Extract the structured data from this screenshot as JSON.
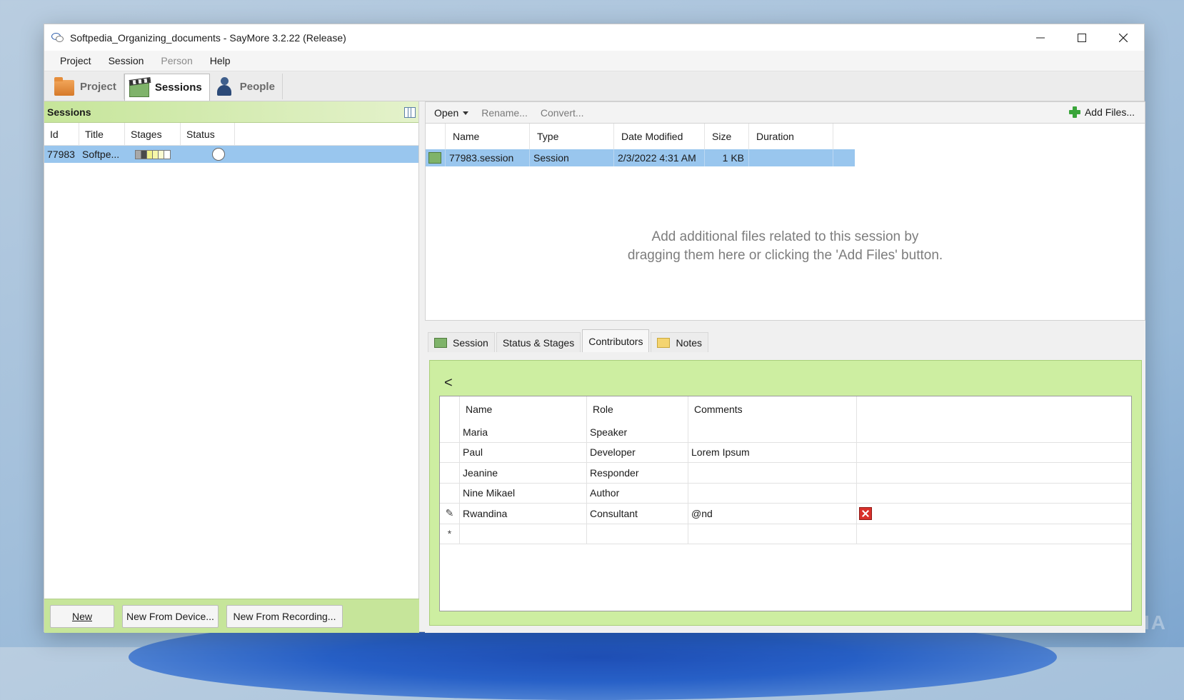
{
  "window": {
    "title": "Softpedia_Organizing_documents - SayMore 3.2.22 (Release)"
  },
  "menu": [
    "Project",
    "Session",
    "Person",
    "Help"
  ],
  "main_tabs": [
    {
      "label": "Project",
      "icon": "folder-icon"
    },
    {
      "label": "Sessions",
      "icon": "clapperboard-icon"
    },
    {
      "label": "People",
      "icon": "person-icon"
    }
  ],
  "sessions_panel": {
    "title": "Sessions",
    "columns": [
      "Id",
      "Title",
      "Stages",
      "Status"
    ],
    "rows": [
      {
        "id": "77983",
        "title": "Softpe...",
        "stage_colors": [
          "#a8a8a8",
          "#4a4a4a",
          "#f2f28a",
          "#f6f6aa",
          "#fafad0",
          "#ffffff"
        ]
      }
    ],
    "buttons": [
      "New",
      "New From Device...",
      "New From Recording..."
    ]
  },
  "file_toolbar": {
    "open": "Open",
    "rename": "Rename...",
    "convert": "Convert...",
    "add_files": "Add Files..."
  },
  "files": {
    "columns": [
      "Name",
      "Type",
      "Date Modified",
      "Size",
      "Duration"
    ],
    "rows": [
      {
        "name": "77983.session",
        "type": "Session",
        "date": "2/3/2022 4:31 AM",
        "size": "1 KB",
        "duration": ""
      }
    ],
    "hint_line1": "Add additional files related to this session by",
    "hint_line2": "dragging them here or clicking the 'Add Files' button."
  },
  "detail_tabs": [
    "Session",
    "Status & Stages",
    "Contributors",
    "Notes"
  ],
  "contributors": {
    "back": "<",
    "columns": [
      "Name",
      "Role",
      "Comments"
    ],
    "rows": [
      {
        "marker": "",
        "name": "Maria",
        "role": "Speaker",
        "comments": ""
      },
      {
        "marker": "",
        "name": "Paul",
        "role": "Developer",
        "comments": "Lorem Ipsum"
      },
      {
        "marker": "",
        "name": "Jeanine",
        "role": "Responder",
        "comments": ""
      },
      {
        "marker": "",
        "name": "Nine Mikael",
        "role": "Author",
        "comments": ""
      },
      {
        "marker": "✎",
        "name": "Rwandina",
        "role": "Consultant",
        "comments": "@nd"
      },
      {
        "marker": "*",
        "name": "",
        "role": "",
        "comments": ""
      }
    ]
  },
  "watermark": "SOFTPEDIA"
}
